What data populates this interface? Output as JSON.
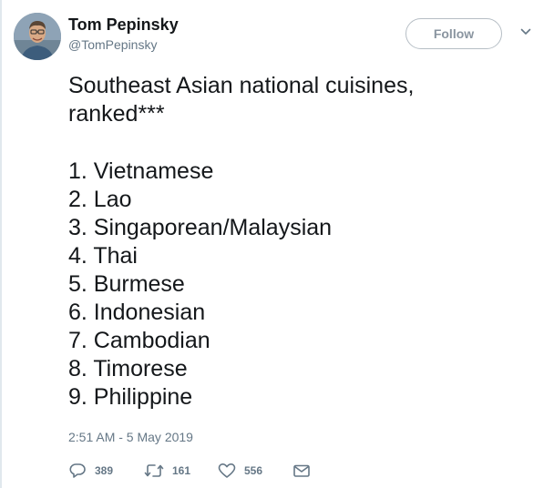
{
  "user": {
    "display_name": "Tom Pepinsky",
    "handle": "@TomPepinsky"
  },
  "follow_button": {
    "label": "Follow"
  },
  "tweet": {
    "title_lines": [
      "Southeast Asian national cuisines,",
      "ranked***"
    ],
    "ranking": [
      "1. Vietnamese",
      "2. Lao",
      "3. Singaporean/Malaysian",
      "4. Thai",
      "5. Burmese",
      "6. Indonesian",
      "7. Cambodian",
      "8. Timorese",
      "9. Philippine"
    ],
    "timestamp": "2:51 AM - 5 May 2019"
  },
  "actions": {
    "reply": {
      "icon": "reply-icon",
      "count": "389"
    },
    "retweet": {
      "icon": "retweet-icon",
      "count": "161"
    },
    "like": {
      "icon": "heart-icon",
      "count": "556"
    },
    "message": {
      "icon": "envelope-icon"
    }
  },
  "colors": {
    "text": "#14171a",
    "secondary": "#657786",
    "follow_border": "#b6bec5"
  }
}
